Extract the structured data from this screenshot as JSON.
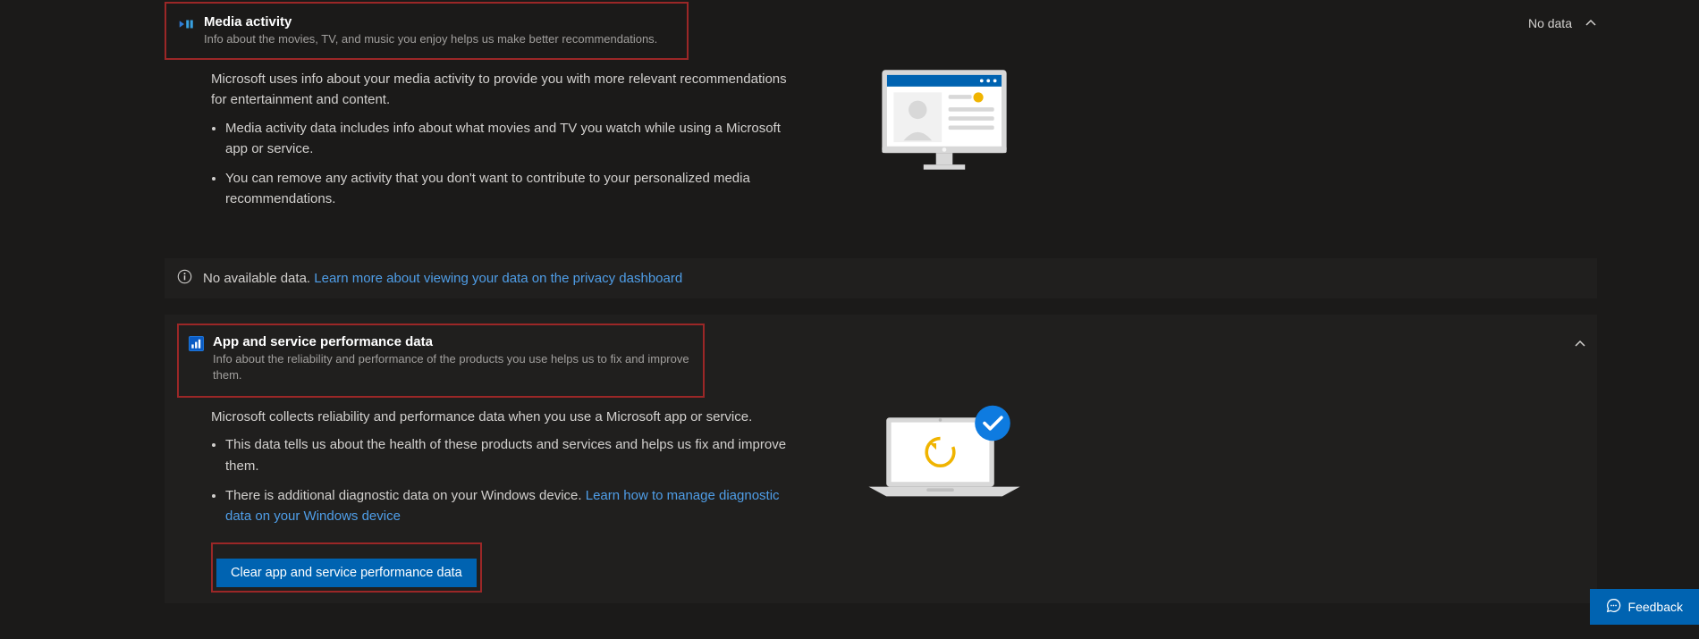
{
  "media": {
    "title": "Media activity",
    "subtitle": "Info about the movies, TV, and music you enjoy helps us make better recommendations.",
    "status": "No data",
    "intro": "Microsoft uses info about your media activity to provide you with more relevant recommendations for entertainment and content.",
    "bullets": [
      "Media activity data includes info about what movies and TV you watch while using a Microsoft app or service.",
      "You can remove any activity that you don't want to contribute to your personalized media recommendations."
    ]
  },
  "notif": {
    "prefix": "No available data.",
    "link": "Learn more about viewing your data on the privacy dashboard"
  },
  "perf": {
    "title": "App and service performance data",
    "subtitle": "Info about the reliability and performance of the products you use helps us to fix and improve them.",
    "intro": "Microsoft collects reliability and performance data when you use a Microsoft app or service.",
    "bullets": [
      "This data tells us about the health of these products and services and helps us fix and improve them.",
      "There is additional diagnostic data on your Windows device."
    ],
    "bullet2_link": "Learn how to manage diagnostic data on your Windows device",
    "clear_btn": "Clear app and service performance data"
  },
  "feedback": "Feedback"
}
